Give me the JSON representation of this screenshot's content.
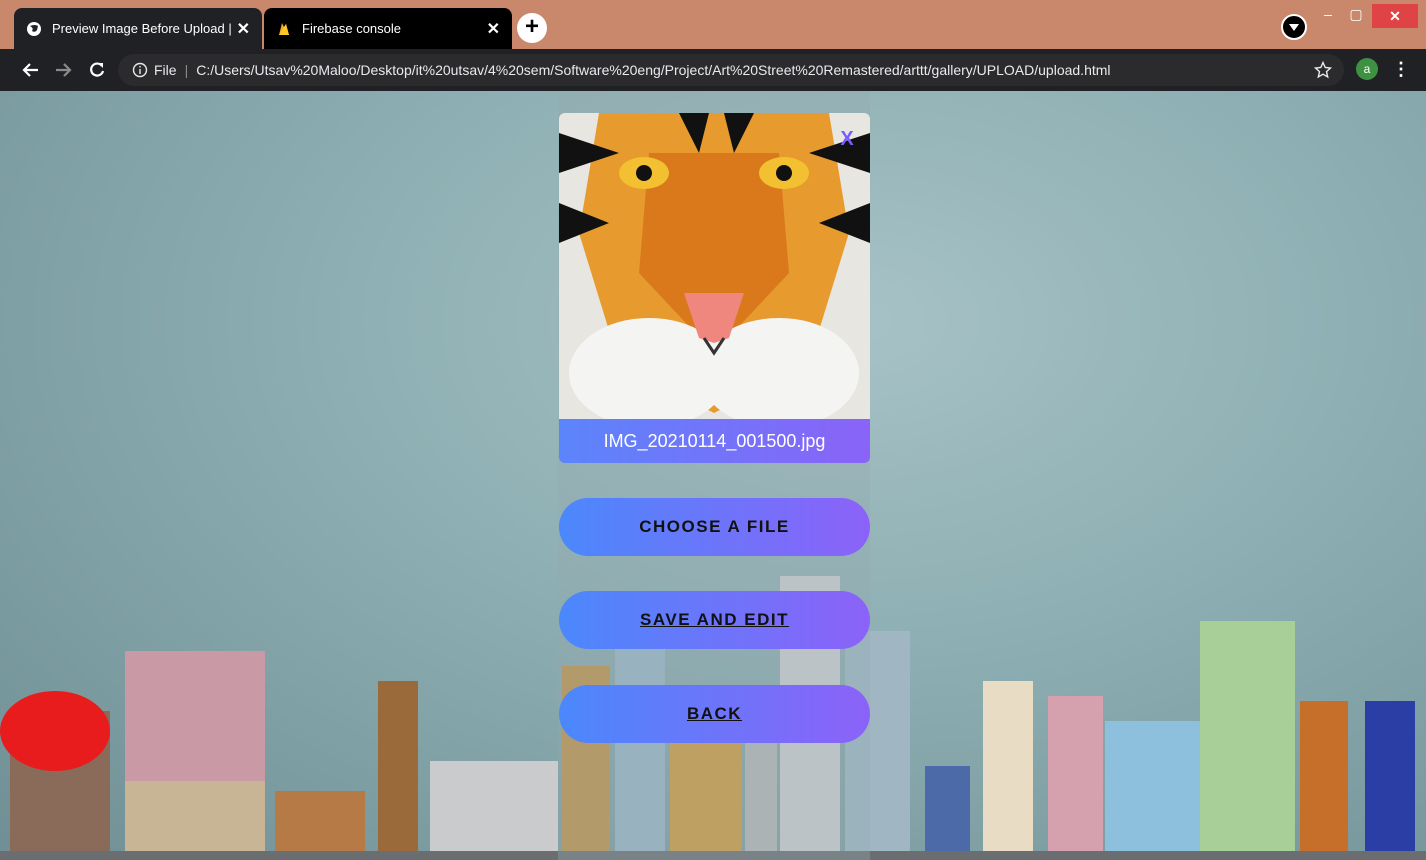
{
  "browser": {
    "tabs": [
      {
        "title": "Preview Image Before Upload | C",
        "favicon": "globe-icon",
        "active": true
      },
      {
        "title": "Firebase console",
        "favicon": "firebase-flame-icon",
        "active": false
      }
    ],
    "new_tab_label": "+",
    "address": {
      "scheme_label": "File",
      "url": "C:/Users/Utsav%20Maloo/Desktop/it%20utsav/4%20sem/Software%20eng/Project/Art%20Street%20Remastered/arttt/gallery/UPLOAD/upload.html"
    },
    "profile_initial": "a",
    "window_controls": {
      "minimize": "–",
      "maximize": "▢",
      "close": "✕"
    }
  },
  "preview": {
    "filename": "IMG_20210114_001500.jpg",
    "remove_label": "X",
    "image_subject": "tiger-painting"
  },
  "actions": {
    "choose_label": "CHOOSE A FILE",
    "save_label": "SAVE AND EDIT",
    "back_label": "BACK"
  },
  "colors": {
    "titlebar": "#c9876b",
    "button_gradient_start": "#4b88fc",
    "button_gradient_end": "#8c62f9",
    "remove_x": "#7a5cff"
  }
}
